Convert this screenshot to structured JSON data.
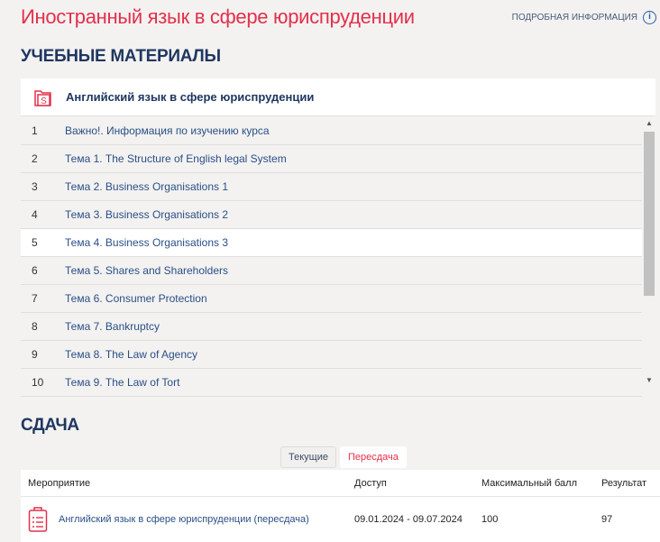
{
  "header": {
    "title": "Иностранный язык в сфере юриспруденции",
    "info_link": "ПОДРОБНАЯ ИНФОРМАЦИЯ",
    "info_icon": "i"
  },
  "materials": {
    "heading": "УЧЕБНЫЕ МАТЕРИАЛЫ",
    "course": "Английский язык в сфере юриспруденции",
    "items": [
      {
        "n": "1",
        "title": "Важно!. Информация по изучению курса"
      },
      {
        "n": "2",
        "title": "Тема 1. The Structure of English legal System"
      },
      {
        "n": "3",
        "title": "Тема 2. Business Organisations 1"
      },
      {
        "n": "4",
        "title": "Тема 3. Business Organisations 2"
      },
      {
        "n": "5",
        "title": "Тема 4. Business Organisations 3"
      },
      {
        "n": "6",
        "title": "Тема 5. Shares and Shareholders"
      },
      {
        "n": "7",
        "title": "Тема 6. Consumer Protection"
      },
      {
        "n": "8",
        "title": "Тема 7. Bankruptcy"
      },
      {
        "n": "9",
        "title": "Тема 8. The Law of Agency"
      },
      {
        "n": "10",
        "title": "Тема 9. The Law of Tort"
      }
    ]
  },
  "exam": {
    "heading": "СДАЧА",
    "tabs": [
      "Текущие",
      "Пересдача"
    ],
    "columns": [
      "Мероприятие",
      "Доступ",
      "Максимальный балл",
      "Результат"
    ],
    "rows": [
      {
        "event": "Английский язык в сфере юриспруденции (пересдача)",
        "access": "09.01.2024 - 09.07.2024",
        "max": "100",
        "result": "97"
      }
    ]
  }
}
